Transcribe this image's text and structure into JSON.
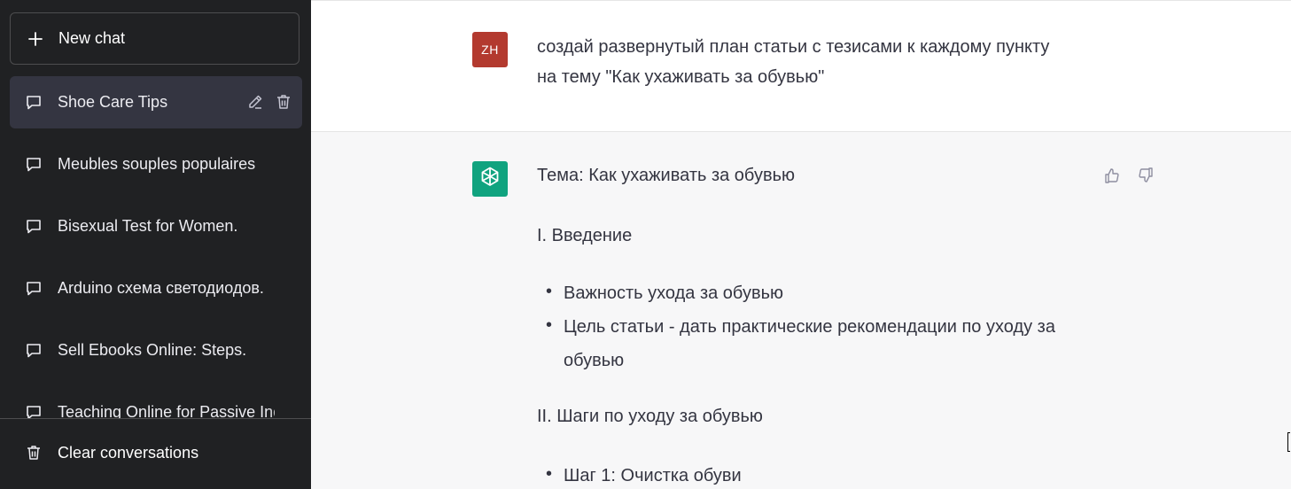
{
  "sidebar": {
    "new_chat_label": "New chat",
    "chats": [
      {
        "label": "Shoe Care Tips",
        "active": true
      },
      {
        "label": "Meubles souples populaires",
        "active": false
      },
      {
        "label": "Bisexual Test for Women.",
        "active": false
      },
      {
        "label": "Arduino схема светодиодов.",
        "active": false
      },
      {
        "label": "Sell Ebooks Online: Steps.",
        "active": false
      },
      {
        "label": "Teaching Online for Passive Inc",
        "active": false
      }
    ],
    "clear_label": "Clear conversations"
  },
  "conversation": {
    "user": {
      "avatar_initials": "ZH",
      "avatar_color": "#b33a2f",
      "lines": [
        "создай развернутый план статьи с тезисами к каждому пункту",
        "на тему \"Как ухаживать за обувью\""
      ]
    },
    "assistant": {
      "avatar_color": "#10a37f",
      "topic": "Тема: Как ухаживать за обувью",
      "section1_title": "I. Введение",
      "section1_bullets": [
        "Важность ухода за обувью",
        "Цель статьи - дать практические рекомендации по уходу за обувью"
      ],
      "section2_title": "II. Шаги по уходу за обувью",
      "section2_bullets": [
        "Шаг 1: Очистка обуви"
      ]
    }
  },
  "icons": {
    "new_chat": "plus-icon",
    "chat": "message-icon",
    "edit": "pencil-icon",
    "delete": "trash-icon",
    "clear": "trash-icon",
    "thumbs_up": "thumbs-up-icon",
    "thumbs_down": "thumbs-down-icon",
    "assistant_avatar": "openai-logo-icon"
  }
}
